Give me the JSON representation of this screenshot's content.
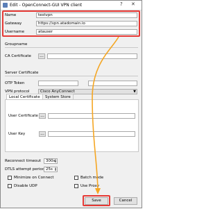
{
  "window": {
    "title": "Edit - OpenConnect-GUI VPN client"
  },
  "fields": {
    "name": {
      "label": "Name",
      "value": "testvpn"
    },
    "gateway": {
      "label": "Gateway",
      "value": "https://vpn.atadomain.io"
    },
    "username": {
      "label": "Username",
      "value": "atauser"
    },
    "groupname": {
      "label": "Groupname",
      "value": ""
    },
    "ca_certificate": {
      "label": "CA Certificate",
      "value": ""
    }
  },
  "server_certificate": {
    "label": "Server Certificate",
    "value": ""
  },
  "otp_token": {
    "label": "OTP Token",
    "value": ""
  },
  "vpn_protocol": {
    "label": "VPN protocol",
    "value": "Cisco AnyConnect"
  },
  "tabs": [
    {
      "label": "Local Certificate"
    },
    {
      "label": "System Store"
    }
  ],
  "local_cert": {
    "user_certificate_label": "User Certificate",
    "user_key_label": "User Key"
  },
  "reconnect": {
    "label": "Reconnect timeout",
    "value": "300s"
  },
  "dtls": {
    "label": "DTLS attempt period",
    "value": "25s"
  },
  "checkboxes": {
    "minimize": "Minimize on Connect",
    "batch_mode": "Batch mode",
    "disable_udp": "Disable UDP",
    "use_proxy": "Use Proxy"
  },
  "buttons": {
    "save": "Save",
    "cancel": "Cancel",
    "dots": "..."
  },
  "colors": {
    "highlight": "#e53935",
    "arrow": "#f5a623"
  }
}
